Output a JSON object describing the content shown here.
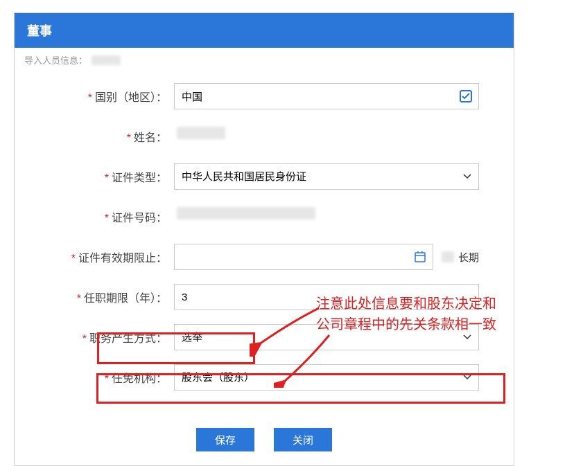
{
  "header": {
    "title": "董事"
  },
  "import_line": {
    "label": "导入人员信息："
  },
  "fields": {
    "country": {
      "label": "国别（地区）：",
      "value": "中国"
    },
    "name": {
      "label": "姓名："
    },
    "idType": {
      "label": "证件类型：",
      "value": "中华人民共和国居民身份证"
    },
    "idNo": {
      "label": "证件号码："
    },
    "idExpiry": {
      "label": "证件有效期限止：",
      "after": "长期"
    },
    "term": {
      "label": "任职期限（年）：",
      "value": "3"
    },
    "method": {
      "label": "职务产生方式：",
      "value": "选举"
    },
    "appointBy": {
      "label": "任免机构：",
      "value": "股东会（股东）"
    }
  },
  "annotation": {
    "line1": "注意此处信息要和股东决定和",
    "line2": "公司章程中的先关条款相一致"
  },
  "footer": {
    "save": "保存",
    "close": "关闭"
  }
}
